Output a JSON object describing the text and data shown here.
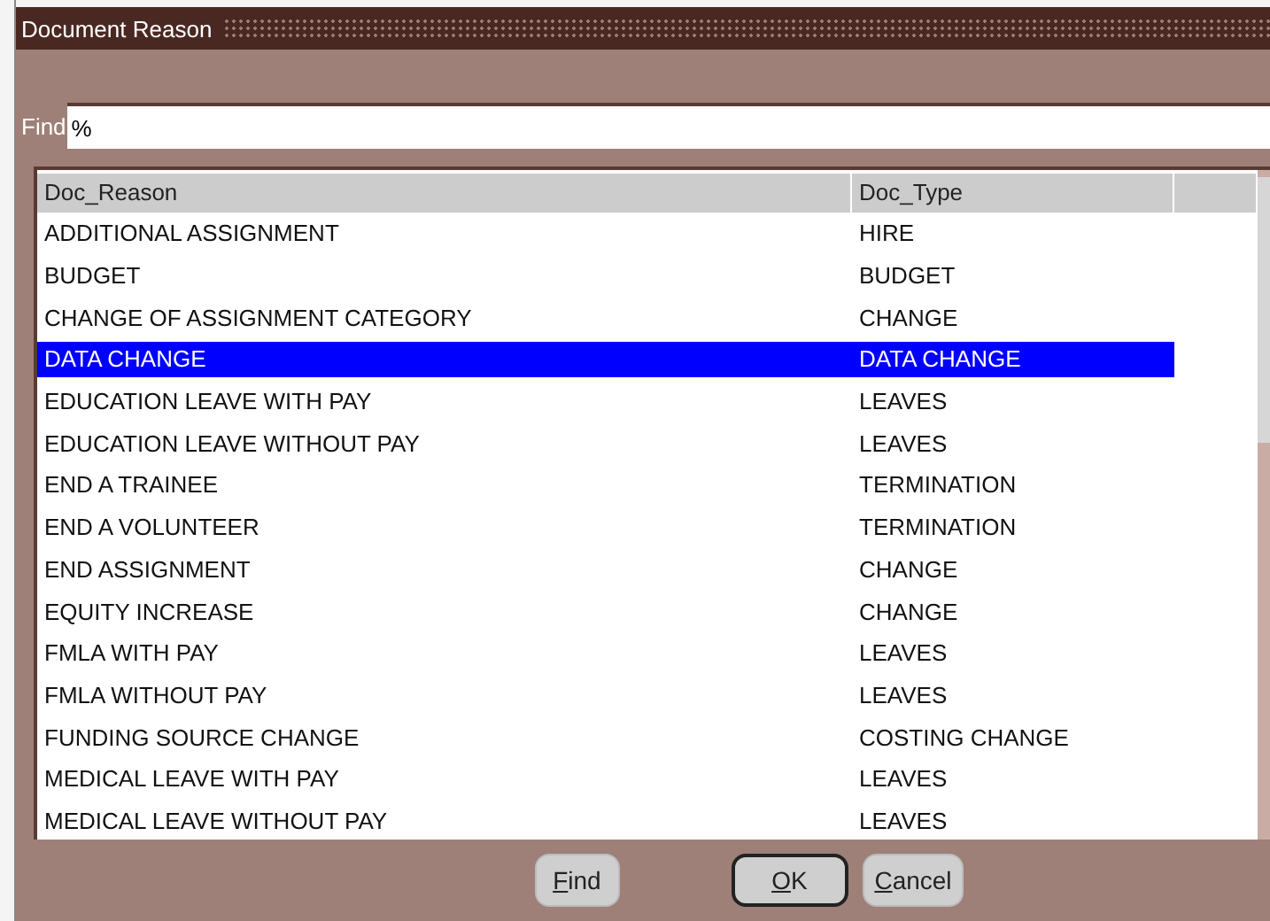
{
  "window": {
    "title": "Document Reason"
  },
  "find": {
    "label": "Find",
    "value": "%"
  },
  "table": {
    "columns": [
      "Doc_Reason",
      "Doc_Type"
    ],
    "rows": [
      {
        "cells": [
          "ADDITIONAL ASSIGNMENT",
          "HIRE"
        ],
        "selected": false
      },
      {
        "cells": [
          "BUDGET",
          "BUDGET"
        ],
        "selected": false
      },
      {
        "cells": [
          "CHANGE OF ASSIGNMENT CATEGORY",
          "CHANGE"
        ],
        "selected": false
      },
      {
        "cells": [
          "DATA CHANGE",
          "DATA CHANGE"
        ],
        "selected": true
      },
      {
        "cells": [
          "EDUCATION LEAVE WITH PAY",
          "LEAVES"
        ],
        "selected": false
      },
      {
        "cells": [
          "EDUCATION LEAVE WITHOUT PAY",
          "LEAVES"
        ],
        "selected": false
      },
      {
        "cells": [
          "END A TRAINEE",
          "TERMINATION"
        ],
        "selected": false
      },
      {
        "cells": [
          "END A VOLUNTEER",
          "TERMINATION"
        ],
        "selected": false
      },
      {
        "cells": [
          "END ASSIGNMENT",
          "CHANGE"
        ],
        "selected": false
      },
      {
        "cells": [
          "EQUITY INCREASE",
          "CHANGE"
        ],
        "selected": false
      },
      {
        "cells": [
          "FMLA WITH PAY",
          "LEAVES"
        ],
        "selected": false
      },
      {
        "cells": [
          "FMLA WITHOUT PAY",
          "LEAVES"
        ],
        "selected": false
      },
      {
        "cells": [
          "FUNDING SOURCE CHANGE",
          "COSTING CHANGE"
        ],
        "selected": false
      },
      {
        "cells": [
          "MEDICAL LEAVE WITH PAY",
          "LEAVES"
        ],
        "selected": false
      },
      {
        "cells": [
          "MEDICAL LEAVE WITHOUT PAY",
          "LEAVES"
        ],
        "selected": false
      }
    ]
  },
  "buttons": [
    {
      "key": "F",
      "rest": "ind",
      "default": false
    },
    {
      "key": "O",
      "rest": "K",
      "default": true
    },
    {
      "key": "C",
      "rest": "ancel",
      "default": false
    }
  ]
}
